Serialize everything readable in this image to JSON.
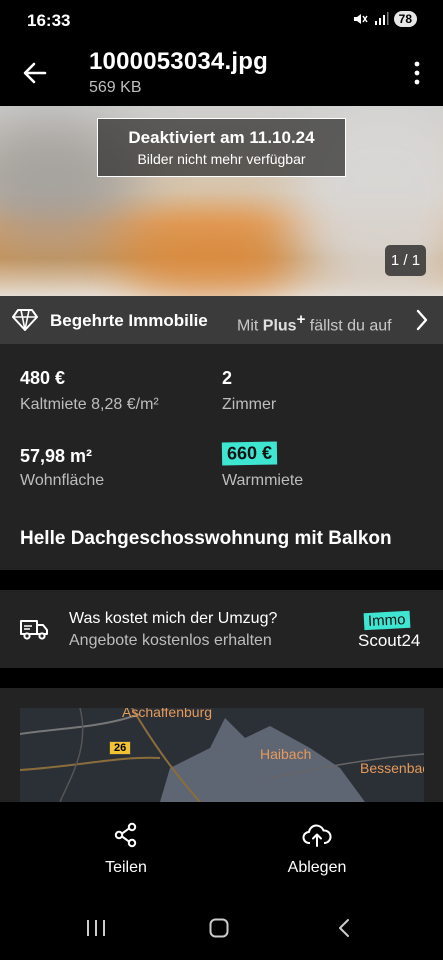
{
  "status_bar": {
    "time": "16:33",
    "battery": "78"
  },
  "header": {
    "title": "1000053034.jpg",
    "file_size": "569 KB"
  },
  "image": {
    "notice_title": "Deaktiviert am 11.10.24",
    "notice_subtitle": "Bilder nicht mehr verfügbar",
    "page_indicator": "1 / 1"
  },
  "plus_banner": {
    "title": "Begehrte Immobilie",
    "text_before": "Mit ",
    "brand": "Plus",
    "plus_sign": "+",
    "text_after": " fällst du auf"
  },
  "details": {
    "cold_rent_value": "480 €",
    "cold_rent_label": "Kaltmiete 8,28 €/m²",
    "rooms_value": "2",
    "rooms_label": "Zimmer",
    "area_value": "57,98 m²",
    "area_label": "Wohnfläche",
    "warm_rent_value": "660 €",
    "warm_rent_label": "Warmmiete",
    "listing_title": "Helle Dachgeschosswohnung mit Balkon"
  },
  "moving": {
    "title": "Was kostet mich der Umzug?",
    "subtitle": "Angebote kostenlos erhalten",
    "logo_top": "Immo",
    "logo_bottom": "Scout24"
  },
  "map": {
    "city_top": "Aschaffenburg",
    "road_number": "26",
    "place_1": "Haibach",
    "place_2": "Bessenbach"
  },
  "actions": {
    "share": "Teilen",
    "save": "Ablegen"
  },
  "colors": {
    "accent_teal": "#3ee6d2",
    "card_bg": "#232323",
    "banner_bg": "#3b3b3b"
  },
  "icons": [
    "back-arrow-icon",
    "more-vert-icon",
    "diamond-icon",
    "chevron-right-icon",
    "truck-icon",
    "share-icon",
    "cloud-upload-icon",
    "recents-icon",
    "home-icon",
    "back-icon"
  ]
}
